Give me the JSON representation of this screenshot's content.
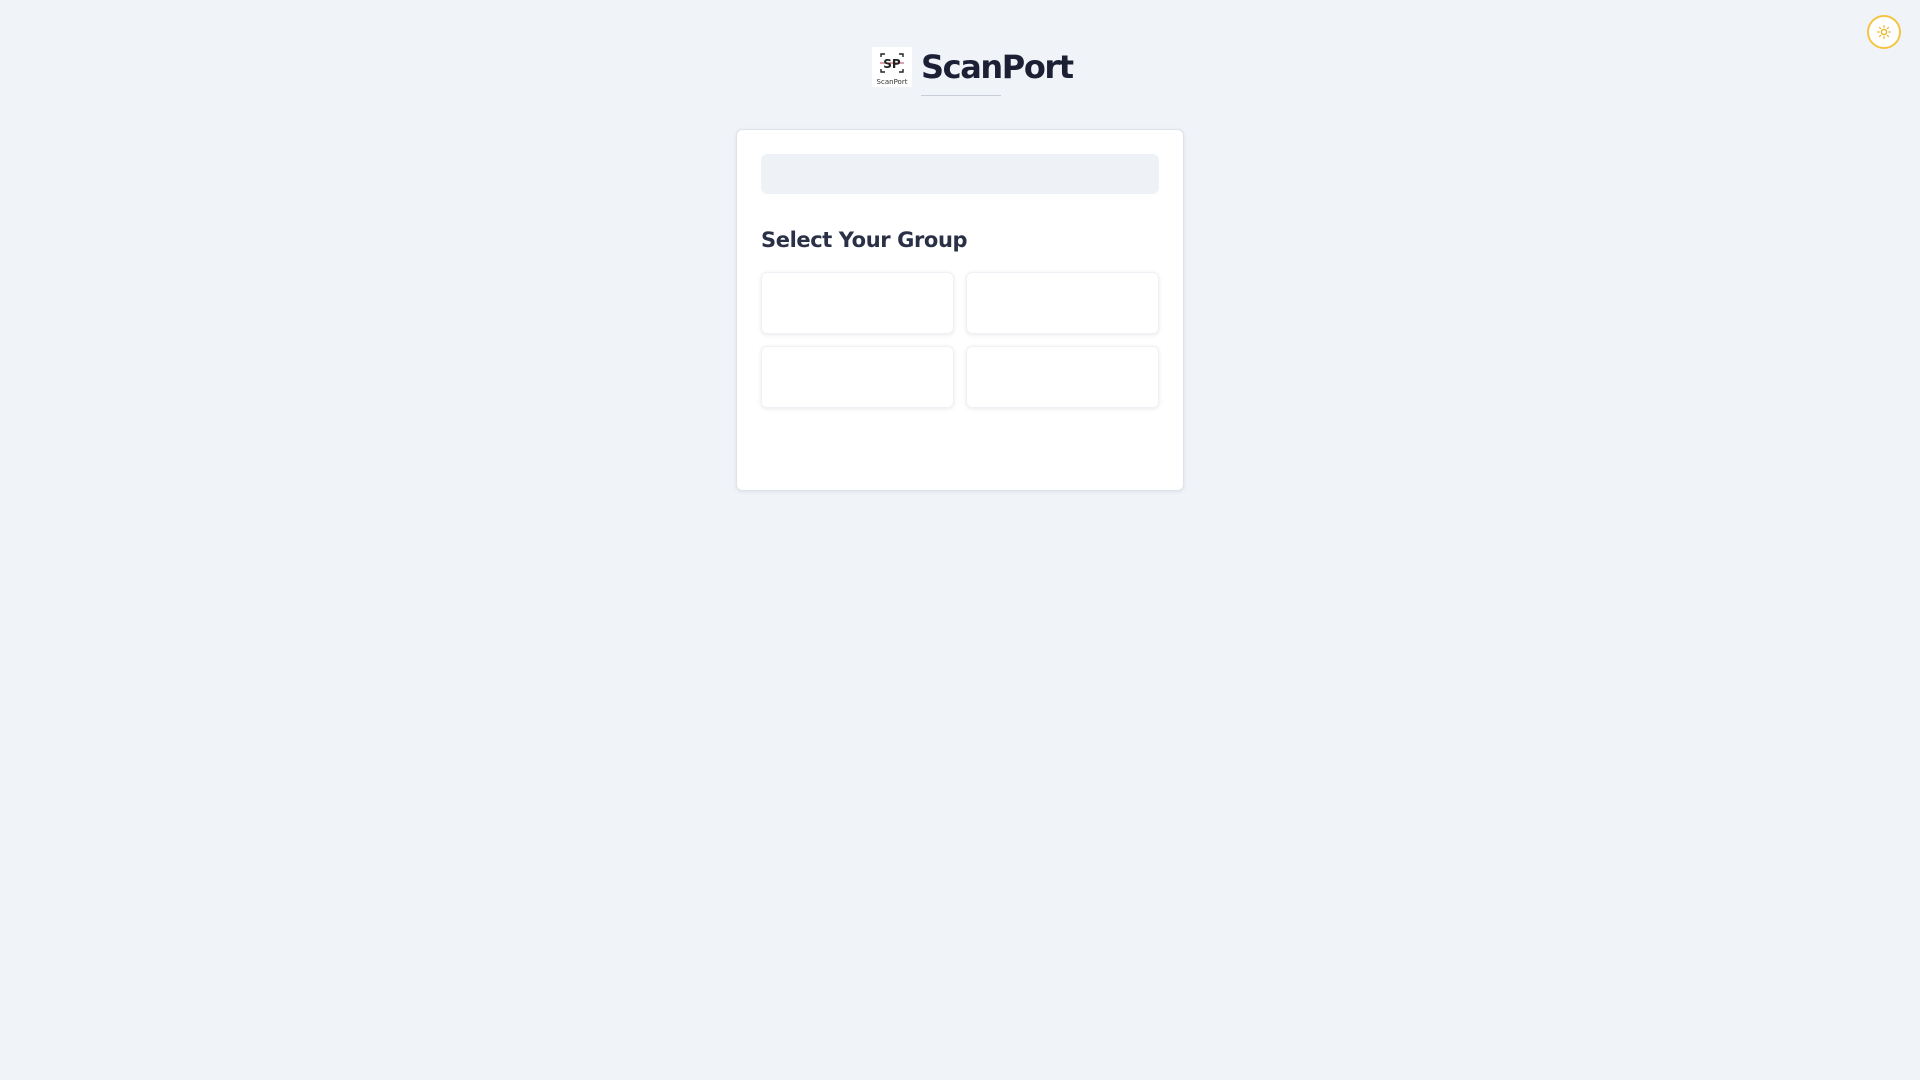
{
  "app": {
    "brand_name": "ScanPort",
    "logo_caption": "ScanPort",
    "logo_icon": "scan-frame-icon"
  },
  "theme_toggle": {
    "icon": "sun-icon",
    "accent_color": "#f4c542"
  },
  "colors": {
    "background": "#f0f4f9",
    "card": "#ffffff",
    "brand_text": "#1b2034"
  },
  "group_selection": {
    "title": "Select Your Group",
    "groups": [
      {
        "label": ""
      },
      {
        "label": ""
      },
      {
        "label": ""
      },
      {
        "label": ""
      }
    ]
  }
}
